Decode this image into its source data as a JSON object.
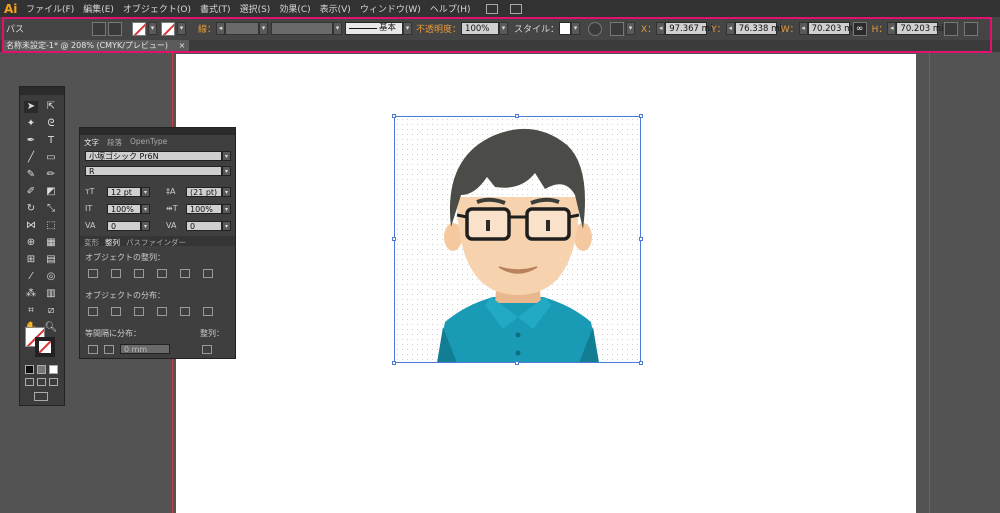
{
  "app": {
    "logo": "Ai"
  },
  "menu": [
    "ファイル(F)",
    "編集(E)",
    "オブジェクト(O)",
    "書式(T)",
    "選択(S)",
    "効果(C)",
    "表示(V)",
    "ウィンドウ(W)",
    "ヘルプ(H)"
  ],
  "control": {
    "mode_label": "パス",
    "stroke_label": "線：",
    "stroke_style": "基本",
    "opacity_label": "不透明度：",
    "opacity_value": "100%",
    "style_label": "スタイル：",
    "x_label": "X：",
    "x_value": "97.367 mi",
    "y_label": "Y：",
    "y_value": "76.338 mi",
    "w_label": "W：",
    "w_value": "70.203 mi",
    "h_label": "H：",
    "h_value": "70.203 mi"
  },
  "document": {
    "tab_title": "名称未設定-1* @ 208% (CMYK/プレビュー)",
    "close": "×"
  },
  "char_panel": {
    "tabs": [
      "文字",
      "段落",
      "OpenType"
    ],
    "font_family": "小塚ゴシック Pr6N",
    "font_style": "R",
    "font_size": "12 pt",
    "leading": "(21 pt)",
    "h_scale": "100%",
    "v_scale": "100%",
    "kerning": "0",
    "tracking": "0"
  },
  "align_panel": {
    "tabs": [
      "変形",
      "整列",
      "パスファインダー"
    ],
    "align_objects": "オブジェクトの整列：",
    "distribute_objects": "オブジェクトの分布：",
    "distribute_spacing": "等間隔に分布：",
    "spacing_value": "0 mm",
    "align_to": "整列："
  },
  "colors": {
    "accent": "#e1126f",
    "selection": "#4b7bd6",
    "shirt": "#1a9bb5"
  }
}
